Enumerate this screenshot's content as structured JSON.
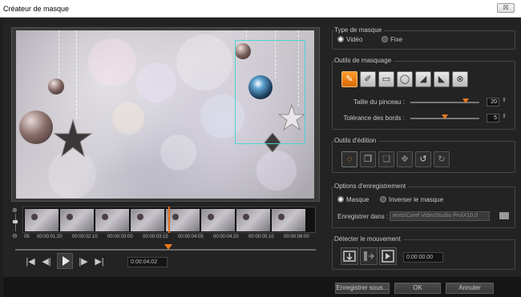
{
  "window": {
    "title": "Créateur de masque",
    "close_label": "☒"
  },
  "preview": {
    "accent_mask": "#49d4d4"
  },
  "timeline": {
    "zoom_in": "⊕",
    "zoom_out": "⊖",
    "timecodes": [
      "05",
      "00:00:01:20",
      "00:00:02:10",
      "00:00:03:00",
      "00:00:03:15",
      "00:00:04:05",
      "00:00:04:20",
      "00:00:05:10",
      "00:00:06:00"
    ],
    "current_time": "0:00:04.02"
  },
  "transport": {
    "start": "|◀",
    "prev": "◀|",
    "next": "|▶",
    "end": "▶|"
  },
  "mask_type": {
    "title": "Type de masque",
    "video_label": "Vidéo",
    "fixed_label": "Fixe",
    "selected": "video"
  },
  "mask_tools": {
    "title": "Outils de masquage",
    "tools": [
      "brush-icon",
      "smart-brush-icon",
      "rect-icon",
      "ellipse-icon",
      "eraser-icon",
      "smart-eraser-icon",
      "clear-icon"
    ],
    "brush_size_label": "Taille du pinceau :",
    "brush_size_value": "20",
    "edge_tolerance_label": "Tolérance des bords :",
    "edge_tolerance_value": "5"
  },
  "edit_tools": {
    "title": "Outils d'édition",
    "tools": [
      "select-transform-icon",
      "copy-icon",
      "paste-icon",
      "move-icon",
      "rotate-left-icon",
      "rotate-right-icon"
    ]
  },
  "save_options": {
    "title": "Options d'enregistrement",
    "mask_label": "Masque",
    "invert_label": "Inverser le masque",
    "save_in_label": "Enregistrer dans :",
    "save_path": "ients\\Corel VideoStudio Pro\\X10.0"
  },
  "motion": {
    "title": "Détecter le mouvement",
    "time": "0:00:00.00"
  },
  "buttons": {
    "save_as": "Enregistrer sous...",
    "ok": "OK",
    "cancel": "Annuler"
  }
}
